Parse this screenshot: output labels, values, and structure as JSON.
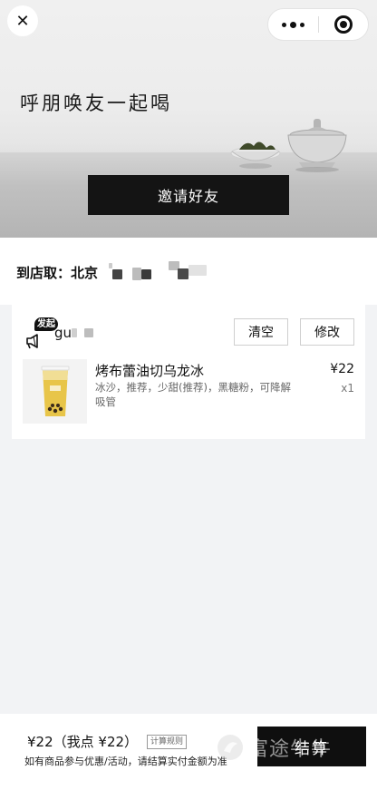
{
  "hero": {
    "title": "呼朋唤友一起喝",
    "invite_label": "邀请好友"
  },
  "nav": {
    "close_glyph": "✕",
    "more_icon": "more-dots-icon",
    "target_icon": "record-target-icon"
  },
  "store": {
    "label": "到店取：",
    "name": "北京"
  },
  "cart": {
    "initiator_badge": "发起",
    "user_name": "gu",
    "clear_label": "清空",
    "edit_label": "修改",
    "item": {
      "name": "烤布蕾油切乌龙冰",
      "spec": "冰沙，推荐，少甜(推荐)，黑糖粉，可降解吸管",
      "price": "¥22",
      "qty": "x1"
    }
  },
  "footer": {
    "total": "¥22（我点 ¥22）",
    "calc_rules": "计算规则",
    "notice": "如有商品参与优惠/活动，请结算实付金额为准",
    "checkout_label": "结算",
    "watermark": "富途牛牛"
  },
  "colors": {
    "accent": "#141414",
    "page_bg": "#f2f3f5"
  }
}
